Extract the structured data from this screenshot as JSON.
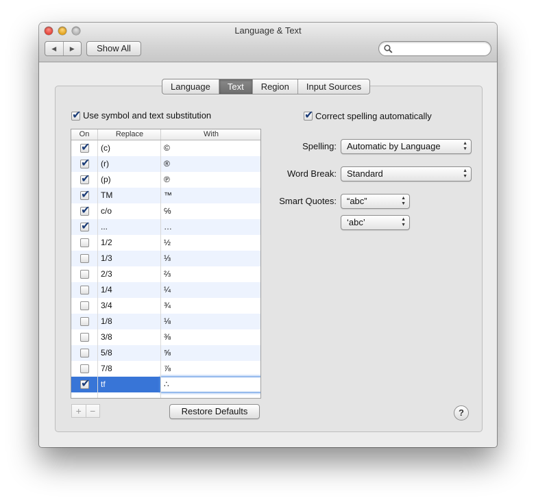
{
  "window": {
    "title": "Language & Text"
  },
  "toolbar": {
    "back_icon": "◀",
    "forward_icon": "▶",
    "show_all_label": "Show All",
    "search_placeholder": ""
  },
  "tabs": [
    {
      "label": "Language",
      "active": false
    },
    {
      "label": "Text",
      "active": true
    },
    {
      "label": "Region",
      "active": false
    },
    {
      "label": "Input Sources",
      "active": false
    }
  ],
  "substitution": {
    "checkbox_label": "Use symbol and text substitution",
    "checked": true,
    "columns": {
      "on": "On",
      "replace": "Replace",
      "with": "With"
    },
    "rows": [
      {
        "on": true,
        "replace": "(c)",
        "with": "©"
      },
      {
        "on": true,
        "replace": "(r)",
        "with": "®"
      },
      {
        "on": true,
        "replace": "(p)",
        "with": "℗"
      },
      {
        "on": true,
        "replace": "TM",
        "with": "™"
      },
      {
        "on": true,
        "replace": "c/o",
        "with": "℅"
      },
      {
        "on": true,
        "replace": "...",
        "with": "…"
      },
      {
        "on": false,
        "replace": "1/2",
        "with": "½"
      },
      {
        "on": false,
        "replace": "1/3",
        "with": "⅓"
      },
      {
        "on": false,
        "replace": "2/3",
        "with": "⅔"
      },
      {
        "on": false,
        "replace": "1/4",
        "with": "¼"
      },
      {
        "on": false,
        "replace": "3/4",
        "with": "¾"
      },
      {
        "on": false,
        "replace": "1/8",
        "with": "⅛"
      },
      {
        "on": false,
        "replace": "3/8",
        "with": "⅜"
      },
      {
        "on": false,
        "replace": "5/8",
        "with": "⅝"
      },
      {
        "on": false,
        "replace": "7/8",
        "with": "⅞"
      },
      {
        "on": true,
        "replace": "tf",
        "with": "∴",
        "selected": true
      }
    ],
    "add_label": "+",
    "remove_label": "−",
    "restore_label": "Restore Defaults"
  },
  "spelling_panel": {
    "correct_label": "Correct spelling automatically",
    "correct_checked": true,
    "spelling_label": "Spelling:",
    "spelling_value": "Automatic by Language",
    "word_break_label": "Word Break:",
    "word_break_value": "Standard",
    "smart_quotes_label": "Smart Quotes:",
    "double_quotes_value": "“abc”",
    "single_quotes_value": "‘abc’"
  },
  "help_label": "?"
}
